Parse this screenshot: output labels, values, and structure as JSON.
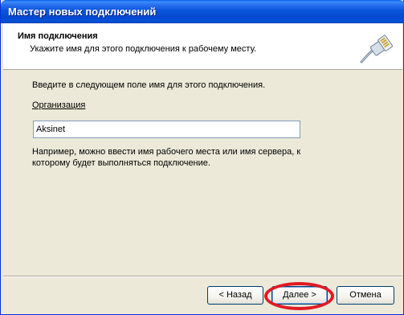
{
  "window": {
    "title": "Мастер новых подключений"
  },
  "header": {
    "title": "Имя подключения",
    "subtitle": "Укажите имя для этого подключения к рабочему месту."
  },
  "content": {
    "prompt": "Введите в следующем поле имя для этого подключения.",
    "field_label": "Организация",
    "field_value": "Aksinet",
    "hint": "Например, можно ввести имя рабочего места или имя сервера, к которому будет выполняться подключение."
  },
  "buttons": {
    "back": "< Назад",
    "next": "Далее >",
    "cancel": "Отмена"
  },
  "colors": {
    "titlebar": "#0A55DA",
    "annotation": "#E01B23",
    "dialog_bg": "#ECE9D8"
  },
  "icons": {
    "header_icon": "network-cable-icon"
  }
}
